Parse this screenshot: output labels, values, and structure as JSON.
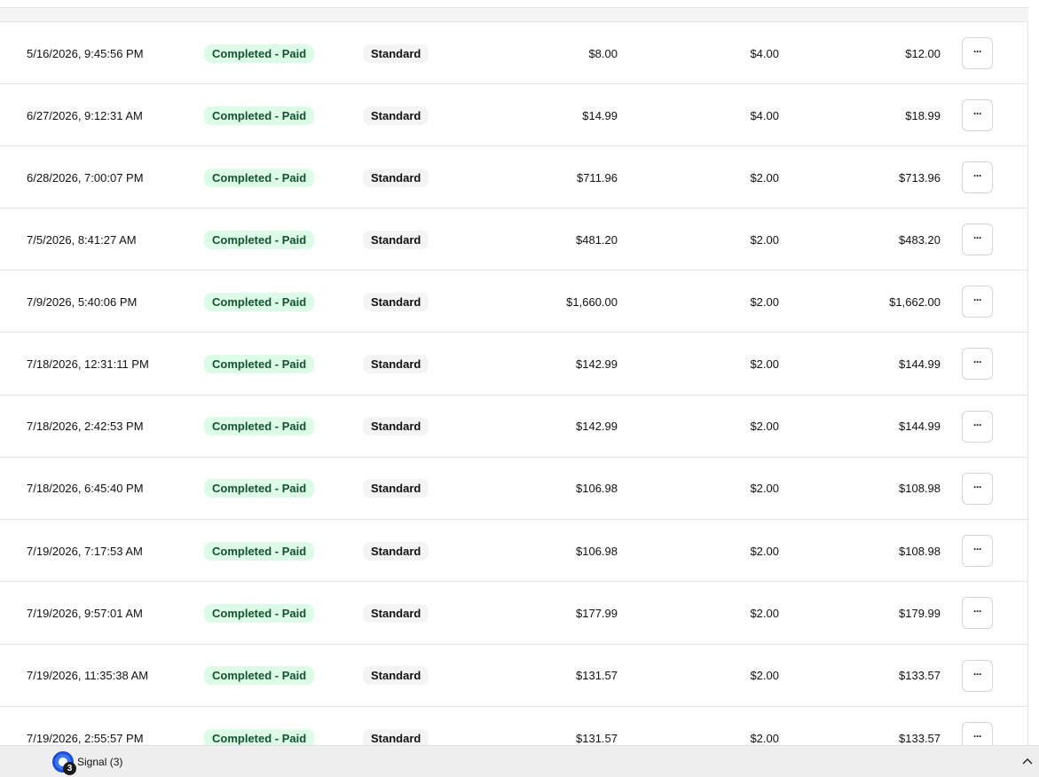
{
  "orders": {
    "rows": [
      {
        "date": "5/16/2026, 9:45:56 PM",
        "status": "Completed - Paid",
        "type": "Standard",
        "subtotal": "$8.00",
        "fee": "$4.00",
        "total": "$12.00"
      },
      {
        "date": "6/27/2026, 9:12:31 AM",
        "status": "Completed - Paid",
        "type": "Standard",
        "subtotal": "$14.99",
        "fee": "$4.00",
        "total": "$18.99"
      },
      {
        "date": "6/28/2026, 7:00:07 PM",
        "status": "Completed - Paid",
        "type": "Standard",
        "subtotal": "$711.96",
        "fee": "$2.00",
        "total": "$713.96"
      },
      {
        "date": "7/5/2026, 8:41:27 AM",
        "status": "Completed - Paid",
        "type": "Standard",
        "subtotal": "$481.20",
        "fee": "$2.00",
        "total": "$483.20"
      },
      {
        "date": "7/9/2026, 5:40:06 PM",
        "status": "Completed - Paid",
        "type": "Standard",
        "subtotal": "$1,660.00",
        "fee": "$2.00",
        "total": "$1,662.00"
      },
      {
        "date": "7/18/2026, 12:31:11 PM",
        "status": "Completed - Paid",
        "type": "Standard",
        "subtotal": "$142.99",
        "fee": "$2.00",
        "total": "$144.99"
      },
      {
        "date": "7/18/2026, 2:42:53 PM",
        "status": "Completed - Paid",
        "type": "Standard",
        "subtotal": "$142.99",
        "fee": "$2.00",
        "total": "$144.99"
      },
      {
        "date": "7/18/2026, 6:45:40 PM",
        "status": "Completed - Paid",
        "type": "Standard",
        "subtotal": "$106.98",
        "fee": "$2.00",
        "total": "$108.98"
      },
      {
        "date": "7/19/2026, 7:17:53 AM",
        "status": "Completed - Paid",
        "type": "Standard",
        "subtotal": "$106.98",
        "fee": "$2.00",
        "total": "$108.98"
      },
      {
        "date": "7/19/2026, 9:57:01 AM",
        "status": "Completed - Paid",
        "type": "Standard",
        "subtotal": "$177.99",
        "fee": "$2.00",
        "total": "$179.99"
      },
      {
        "date": "7/19/2026, 11:35:38 AM",
        "status": "Completed - Paid",
        "type": "Standard",
        "subtotal": "$131.57",
        "fee": "$2.00",
        "total": "$133.57"
      },
      {
        "date": "7/19/2026, 2:55:57 PM",
        "status": "Completed - Paid",
        "type": "Standard",
        "subtotal": "$131.57",
        "fee": "$2.00",
        "total": "$133.57"
      }
    ],
    "action_label": "···"
  },
  "taskbar": {
    "app_label": "Signal (3)",
    "badge_count": "3",
    "app_icon": "signal-icon",
    "tray_icon": "chevron-up-icon"
  },
  "colors": {
    "status_bg": "#dcfce7",
    "status_text": "#14532d",
    "type_bg": "#f4f4f5"
  }
}
